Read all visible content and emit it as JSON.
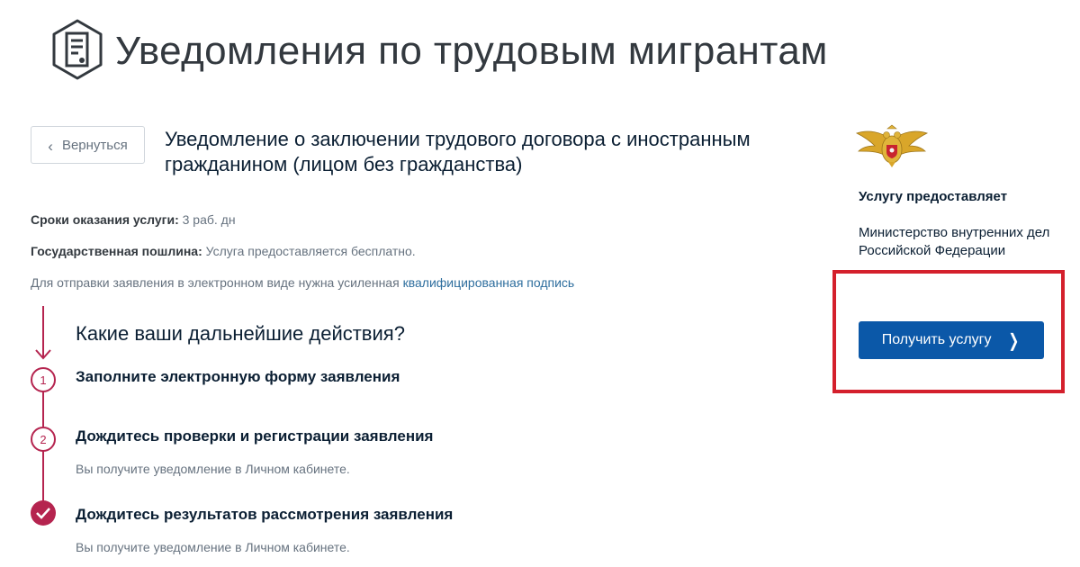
{
  "page": {
    "title": "Уведомления по трудовым мигрантам",
    "icon": "document-icon"
  },
  "back_button": {
    "label": "Вернуться",
    "icon": "chevron-left-icon"
  },
  "service": {
    "title": "Уведомление о заключении трудового договора с иностранным гражданином (лицом без гражданства)"
  },
  "info": {
    "terms_label": "Сроки оказания услуги:",
    "terms_value": "3 раб. дн",
    "fee_label": "Государственная пошлина:",
    "fee_value": "Услуга предоставляется бесплатно.",
    "signature_text": "Для отправки заявления в электронном виде нужна усиленная",
    "signature_link": "квалифицированная подпись"
  },
  "steps": {
    "heading": "Какие ваши дальнейшие действия?",
    "items": [
      {
        "number": "1",
        "title": "Заполните электронную форму заявления",
        "description": ""
      },
      {
        "number": "2",
        "title": "Дождитесь проверки и регистрации заявления",
        "description": "Вы получите уведомление в Личном кабинете."
      },
      {
        "number": "✓",
        "title": "Дождитесь результатов рассмотрения заявления",
        "description": "Вы получите уведомление в Личном кабинете."
      }
    ]
  },
  "provider": {
    "emblem": "mvd-emblem-icon",
    "heading": "Услугу предоставляет",
    "name": "Министерство внутренних дел Российской Федерации"
  },
  "cta": {
    "label": "Получить услугу",
    "icon": "chevron-right-icon"
  },
  "colors": {
    "accent": "#0b58a8",
    "step_color": "#b5244f",
    "highlight": "#d4202c",
    "link": "#2e6e9e"
  }
}
